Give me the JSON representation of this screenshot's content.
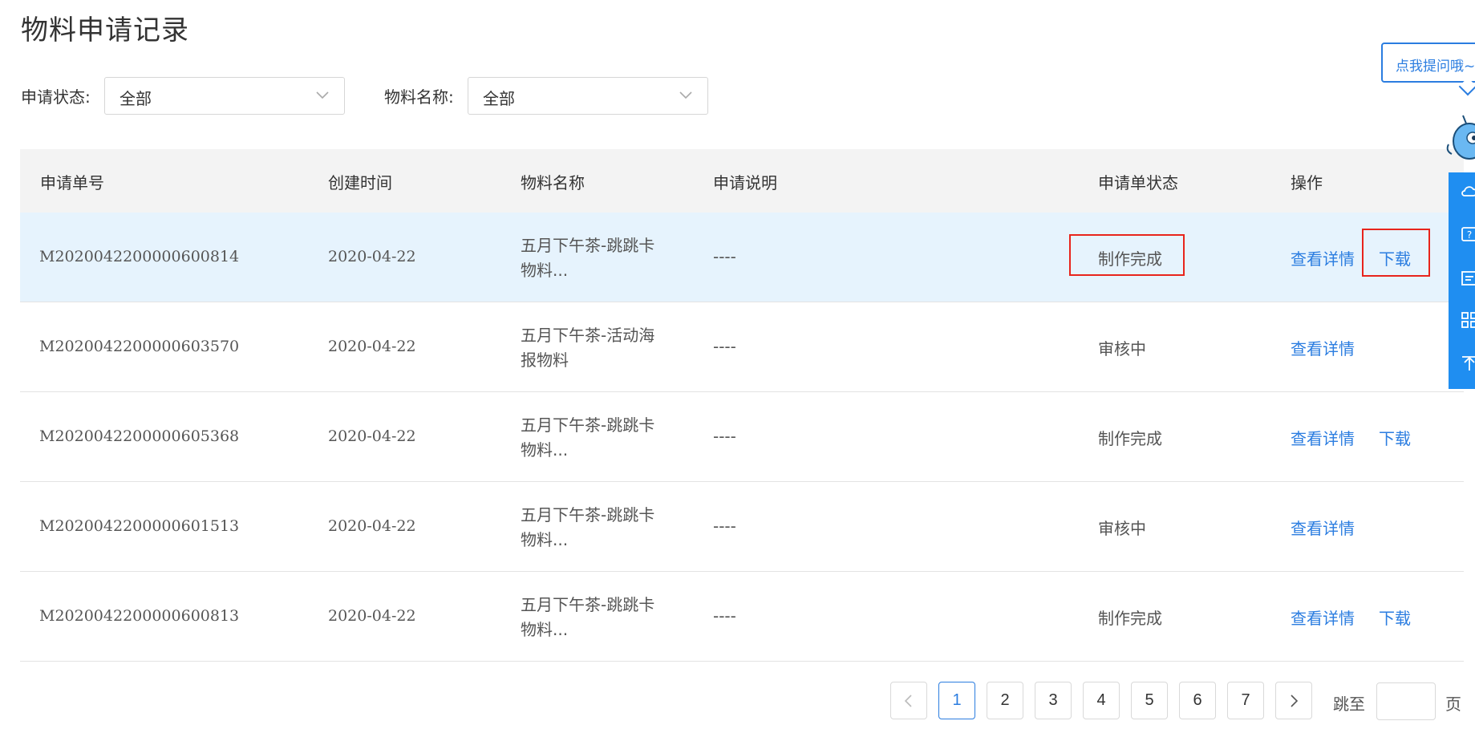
{
  "page": {
    "title": "物料申请记录"
  },
  "filters": {
    "status": {
      "label": "申请状态:",
      "value": "全部"
    },
    "material": {
      "label": "物料名称:",
      "value": "全部"
    }
  },
  "table": {
    "headers": [
      "申请单号",
      "创建时间",
      "物料名称",
      "申请说明",
      "申请单状态",
      "操作"
    ],
    "rows": [
      {
        "id": "M2020042200000600814",
        "date": "2020-04-22",
        "name_line1": "五月下午茶-跳跳卡",
        "name_line2": "物料...",
        "desc": "----",
        "status": "制作完成",
        "view": "查看详情",
        "download": "下载"
      },
      {
        "id": "M2020042200000603570",
        "date": "2020-04-22",
        "name_line1": "五月下午茶-活动海",
        "name_line2": "报物料",
        "desc": "----",
        "status": "审核中",
        "view": "查看详情",
        "download": ""
      },
      {
        "id": "M2020042200000605368",
        "date": "2020-04-22",
        "name_line1": "五月下午茶-跳跳卡",
        "name_line2": "物料...",
        "desc": "----",
        "status": "制作完成",
        "view": "查看详情",
        "download": "下载"
      },
      {
        "id": "M2020042200000601513",
        "date": "2020-04-22",
        "name_line1": "五月下午茶-跳跳卡",
        "name_line2": "物料...",
        "desc": "----",
        "status": "审核中",
        "view": "查看详情",
        "download": ""
      },
      {
        "id": "M2020042200000600813",
        "date": "2020-04-22",
        "name_line1": "五月下午茶-跳跳卡",
        "name_line2": "物料...",
        "desc": "----",
        "status": "制作完成",
        "view": "查看详情",
        "download": "下载"
      }
    ]
  },
  "pagination": {
    "pages": [
      "1",
      "2",
      "3",
      "4",
      "5",
      "6",
      "7"
    ],
    "current": "1",
    "jump_label": "跳至",
    "jump_suffix": "页"
  },
  "help": {
    "tip": "点我提问哦~"
  },
  "colors": {
    "accent": "#2b7de0",
    "highlight_row": "#e6f3fd",
    "annotation_red": "#e8241c",
    "sidebar": "#1f8ef1"
  }
}
